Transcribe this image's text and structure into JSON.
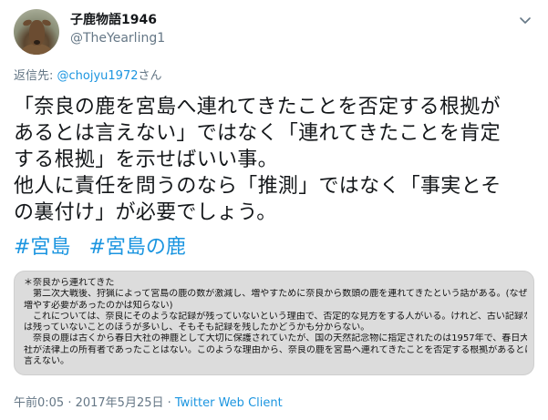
{
  "user": {
    "display_name": "子鹿物語1946",
    "handle": "@TheYearling1"
  },
  "reply": {
    "prefix": "返信先: ",
    "mention": "@chojyu1972",
    "suffix": "さん"
  },
  "tweet": {
    "lines": [
      "「奈良の鹿を宮島へ連れてきたことを否定する根拠が",
      "あるとは言えない」ではなく「連れてきたことを肯定",
      "する根拠」を示せばいい事。",
      "他人に責任を問うのなら「推測」ではなく「事実とそ",
      "の裏付け」が必要でしょう。"
    ],
    "hashtags": [
      "#宮島",
      "#宮島の鹿"
    ]
  },
  "image_note": {
    "lines": [
      "＊奈良から連れてきた",
      "　第二次大戦後、狩猟によって宮島の鹿の数が激減し、増やすために奈良から数頭の鹿を連れてきたという話がある。(なぜ",
      "増やす必要があったのかは知らない)",
      "　これについては、奈良にそのような記録が残っていないという理由で、否定的な見方をする人がいる。けれど、古い記録など",
      "は残っていないことのほうが多いし、そもそも記録を残したかどうかも分からない。",
      "　奈良の鹿は古くから春日大社の神鹿として大切に保護されていたが、国の天然記念物に指定されたのは1957年で、春日大",
      "社が法律上の所有者であったことはない。このような理由から、奈良の鹿を宮島へ連れてきたことを否定する根拠があるとは",
      "言えない。"
    ]
  },
  "footer": {
    "timestamp": "午前0:05 · 2017年5月25日 · ",
    "client": "Twitter Web Client"
  },
  "icons": {
    "caret": "chevron-down-icon",
    "avatar": "deer-avatar"
  },
  "colors": {
    "link": "#1b95e0",
    "muted": "#657786",
    "text": "#14171a"
  }
}
